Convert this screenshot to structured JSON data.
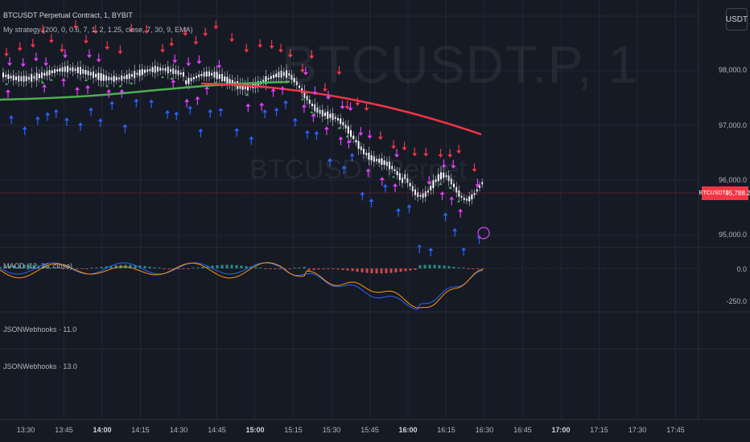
{
  "header": {
    "symbol_line": "BTCUSDT Perpetual Contract, 1, BYBIT",
    "strategy_line": "My strategy (200, 0, 0.6, 7, 1, 2, 1.25, close, 7, 30, 9, EMA)",
    "unit_button": "USDT"
  },
  "watermark": {
    "big": "BTCUSDT.P, 1",
    "small": "BTCUSDT Perpet"
  },
  "price_axis": {
    "ticks": [
      "98,000.0",
      "97,000.0",
      "96,000.0",
      "95,000.0"
    ],
    "last_price": "95,788.2",
    "symbol_tag": "BTCUSDT.P"
  },
  "macd": {
    "label": "MACD (12, 26, close)",
    "ticks": [
      "0.0",
      "-250.0"
    ]
  },
  "panes": [
    {
      "label": "JSONWebhooks · 11.0"
    },
    {
      "label": "JSONWebhooks · 13.0"
    }
  ],
  "time_axis": {
    "labels": [
      {
        "text": "13:30",
        "bold": false
      },
      {
        "text": "13:45",
        "bold": false
      },
      {
        "text": "14:00",
        "bold": true
      },
      {
        "text": "14:15",
        "bold": false
      },
      {
        "text": "14:30",
        "bold": false
      },
      {
        "text": "14:45",
        "bold": false
      },
      {
        "text": "15:00",
        "bold": true
      },
      {
        "text": "15:15",
        "bold": false
      },
      {
        "text": "15:30",
        "bold": false
      },
      {
        "text": "15:45",
        "bold": false
      },
      {
        "text": "16:00",
        "bold": true
      },
      {
        "text": "16:15",
        "bold": false
      },
      {
        "text": "16:30",
        "bold": false
      },
      {
        "text": "16:45",
        "bold": false
      },
      {
        "text": "17:00",
        "bold": true
      },
      {
        "text": "17:15",
        "bold": false
      },
      {
        "text": "17:30",
        "bold": false
      },
      {
        "text": "17:45",
        "bold": false
      }
    ]
  },
  "colors": {
    "background": "#161a25",
    "grid": "#232733",
    "ema_green": "#4caf50",
    "ema_red": "#f23645",
    "sell_arrow": "#f23645",
    "buy_arrow": "#2962ff",
    "exit_marker": "#e040fb",
    "macd_line": "#2962ff",
    "signal_line": "#ff9800",
    "hist_up": "#26a69a",
    "hist_down": "#ef5350"
  }
}
